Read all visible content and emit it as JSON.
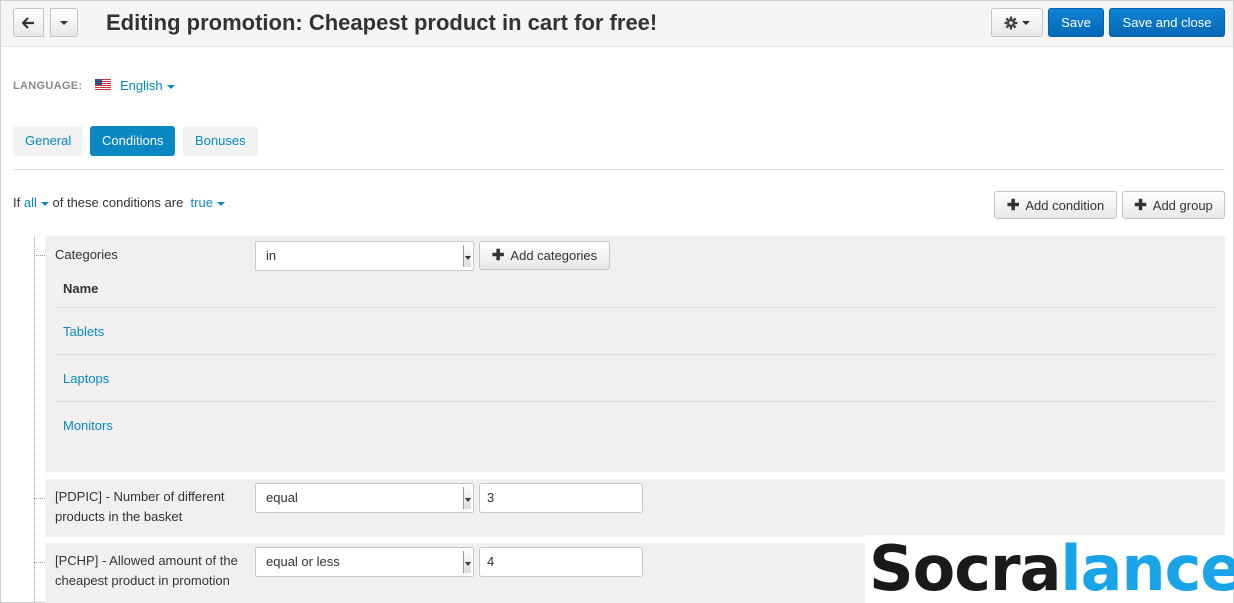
{
  "header": {
    "title": "Editing promotion: Cheapest product in cart for free!",
    "save_label": "Save",
    "save_close_label": "Save and close"
  },
  "language": {
    "label": "LANGUAGE:",
    "value": "English"
  },
  "tabs": [
    {
      "label": "General",
      "active": false
    },
    {
      "label": "Conditions",
      "active": true
    },
    {
      "label": "Bonuses",
      "active": false
    }
  ],
  "conditions_sentence": {
    "prefix": "If",
    "quantifier": "all",
    "middle": "of these conditions are",
    "value": "true"
  },
  "actions": {
    "add_condition": "Add condition",
    "add_group": "Add group"
  },
  "conditions": [
    {
      "label": "Categories",
      "operator": "in",
      "add_button": "Add categories",
      "table_header": "Name",
      "items": [
        "Tablets",
        "Laptops",
        "Monitors"
      ]
    },
    {
      "label_line1": "[PDPIC] - Number of different",
      "label_line2": "products in the basket",
      "operator": "equal",
      "value": "3"
    },
    {
      "label_line1": "[PCHP] - Allowed amount of the",
      "label_line2": "cheapest product in promotion",
      "operator": "equal or less",
      "value": "4"
    }
  ],
  "watermark": {
    "part1": "Socra",
    "part2": "lance"
  },
  "colors": {
    "accent": "#0a88c4",
    "primary_button": "#0668b3",
    "panel": "#f0f0f0"
  }
}
